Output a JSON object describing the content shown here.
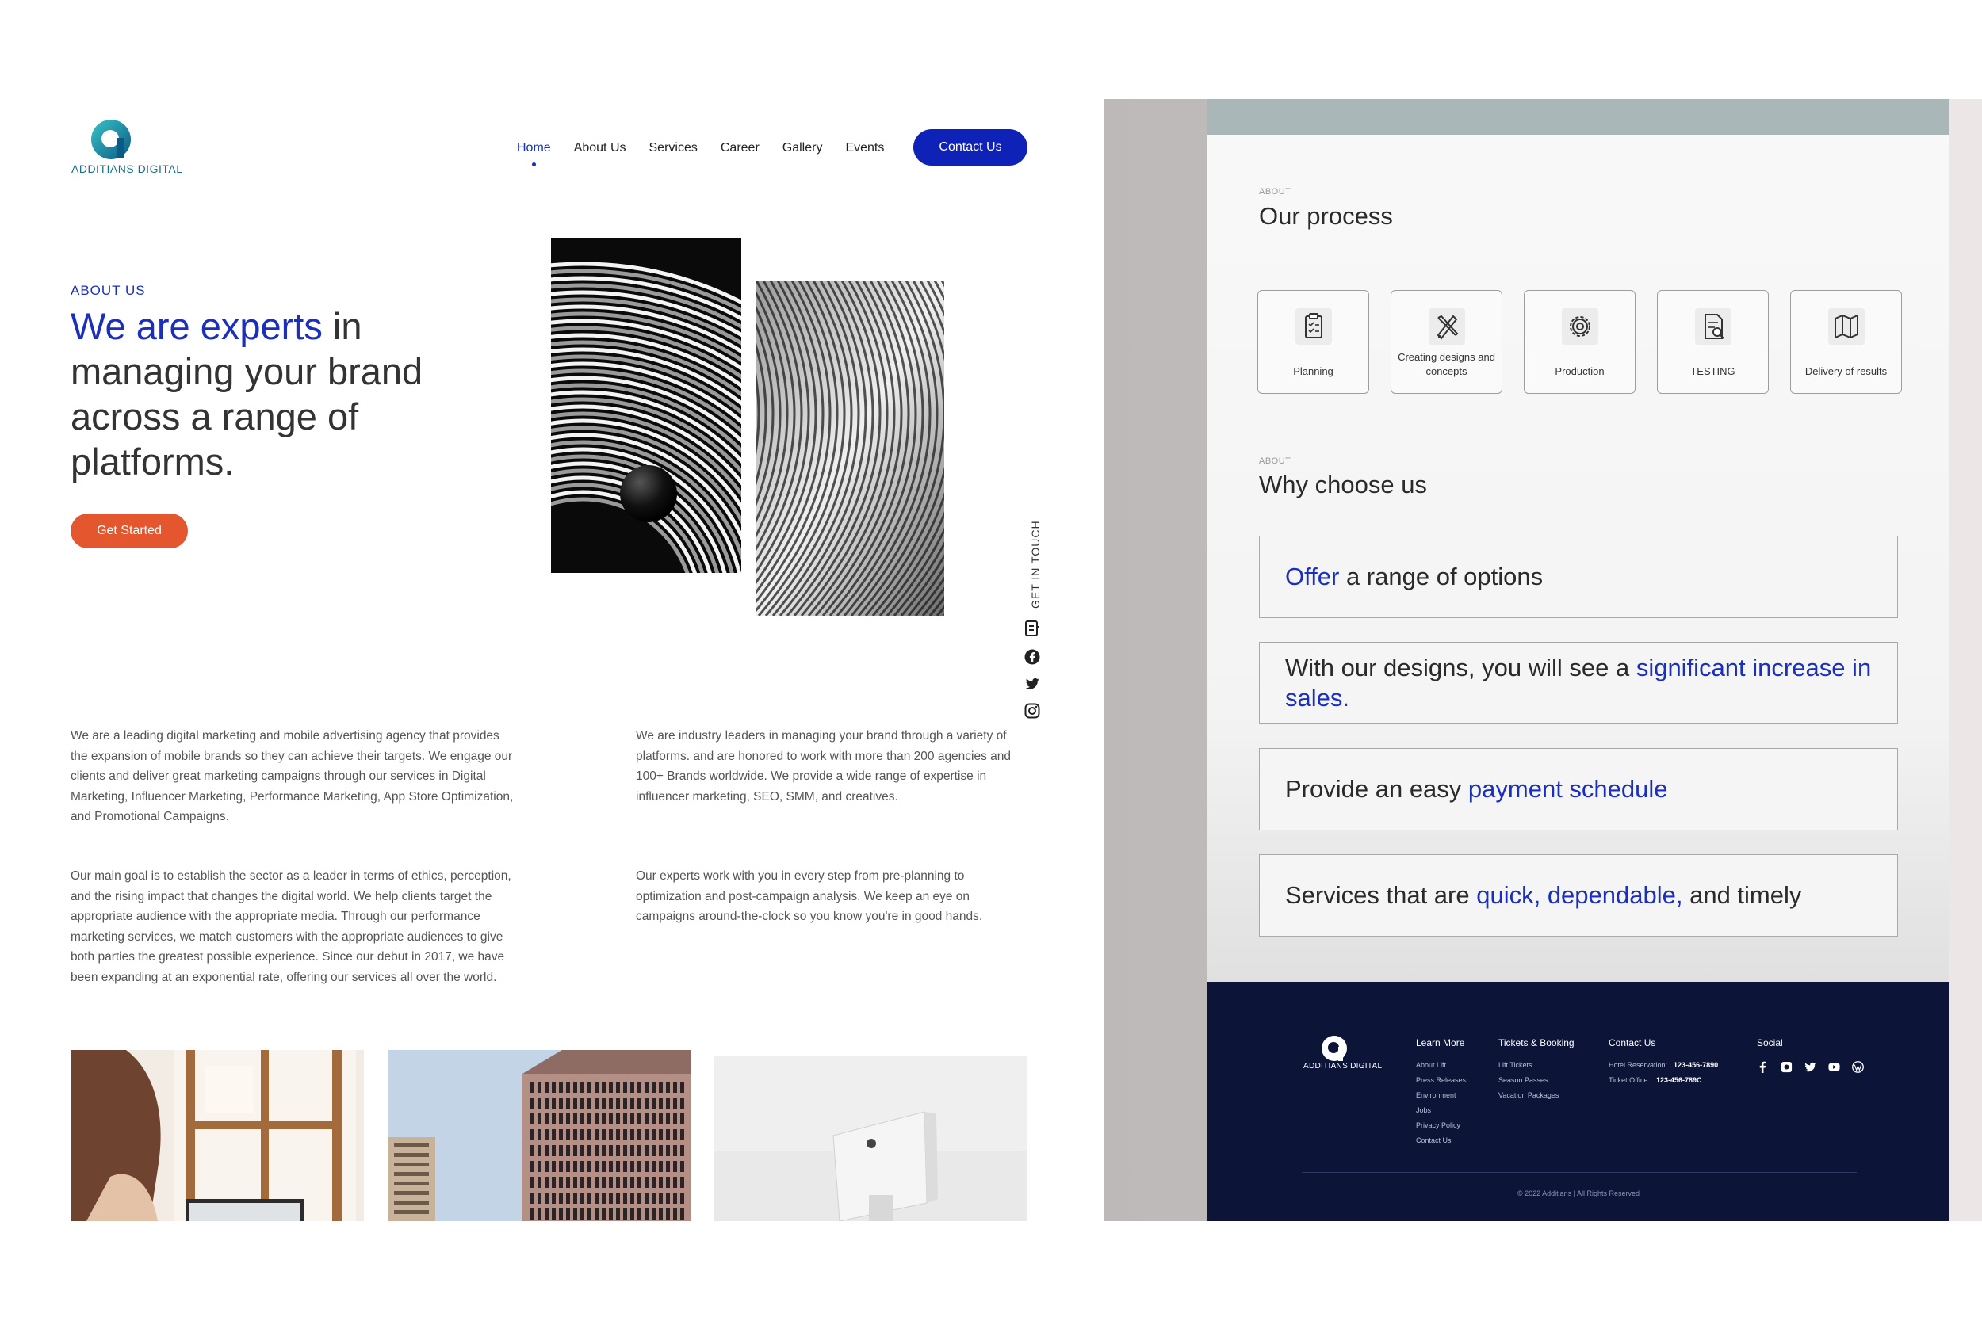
{
  "left": {
    "logo_text": "ADDITIANS DIGITAL",
    "nav": [
      {
        "label": "Home",
        "active": true
      },
      {
        "label": "About Us"
      },
      {
        "label": "Services"
      },
      {
        "label": "Career"
      },
      {
        "label": "Gallery"
      },
      {
        "label": "Events"
      }
    ],
    "contact_button": "Contact Us",
    "eyebrow": "ABOUT US",
    "hero_accent": "We are experts",
    "hero_rest": " in managing your brand across a range of platforms.",
    "cta": "Get Started",
    "get_in_touch": "GET IN TOUCH",
    "paragraphs": [
      "We are a leading digital marketing and mobile advertising agency that provides the expansion of mobile brands so they can achieve their targets. We engage our clients and deliver great marketing campaigns through our services in Digital Marketing, Influencer Marketing, Performance Marketing, App Store Optimization, and Promotional Campaigns.",
      "We are industry leaders in managing your brand through a variety of platforms. and are honored to work with more than 200 agencies and 100+ Brands worldwide. We provide a wide range of expertise in influencer marketing, SEO, SMM, and creatives.",
      "Our main goal is to establish the sector as a leader in terms of ethics, perception, and the rising impact that changes the digital world. We help clients target the appropriate audience with the appropriate media. Through our performance marketing services, we match customers with the appropriate audiences to give both parties the greatest possible experience. Since our debut in 2017, we have been expanding at an exponential rate, offering our services all over the world.",
      "Our experts work with you in every step from pre-planning to optimization and post-campaign analysis. We keep an eye on campaigns around-the-clock so you know you're in good hands."
    ]
  },
  "right": {
    "process_eyebrow": "ABOUT",
    "process_title": "Our process",
    "process_steps": [
      {
        "label": "Planning",
        "icon": "clipboard-icon"
      },
      {
        "label": "Creating designs and concepts",
        "icon": "design-tools-icon"
      },
      {
        "label": "Production",
        "icon": "gear-icon"
      },
      {
        "label": "TESTING",
        "icon": "test-document-icon"
      },
      {
        "label": "Delivery of results",
        "icon": "map-icon"
      }
    ],
    "why_eyebrow": "ABOUT",
    "why_title": "Why choose us",
    "why": [
      {
        "a": "",
        "hl": "Offer",
        "b": " a range of options"
      },
      {
        "a": "With our designs, you will see a ",
        "hl": "significant increase in sales.",
        "b": ""
      },
      {
        "a": "Provide an easy ",
        "hl": "payment schedule",
        "b": ""
      },
      {
        "a": "Services that are ",
        "hl": "quick, dependable,",
        "b": " and timely"
      }
    ],
    "footer": {
      "logo_text": "ADDITIANS DIGITAL",
      "learn_more": {
        "title": "Learn More",
        "links": [
          "About Lift",
          "Press Releases",
          "Environment",
          "Jobs",
          "Privacy Policy",
          "Contact Us"
        ]
      },
      "tickets": {
        "title": "Tickets & Booking",
        "links": [
          "Lift Tickets",
          "Season Passes",
          "Vacation Packages"
        ]
      },
      "contact": {
        "title": "Contact Us",
        "hotel_label": "Hotel Reservation:",
        "hotel_number": "123-456-7890",
        "ticket_label": "Ticket Office:",
        "ticket_number": "123-456-789C"
      },
      "social_title": "Social",
      "social_icons": [
        "facebook-icon",
        "instagram-icon",
        "twitter-icon",
        "youtube-icon",
        "wordpress-icon"
      ],
      "copyright": "© 2022 Additians | All Rights Reserved"
    }
  },
  "colors": {
    "accent_blue": "#1a2fbd",
    "cta_orange": "#e4562d",
    "footer_navy": "#0c1538",
    "logo_teal": "#1a8aa6"
  }
}
